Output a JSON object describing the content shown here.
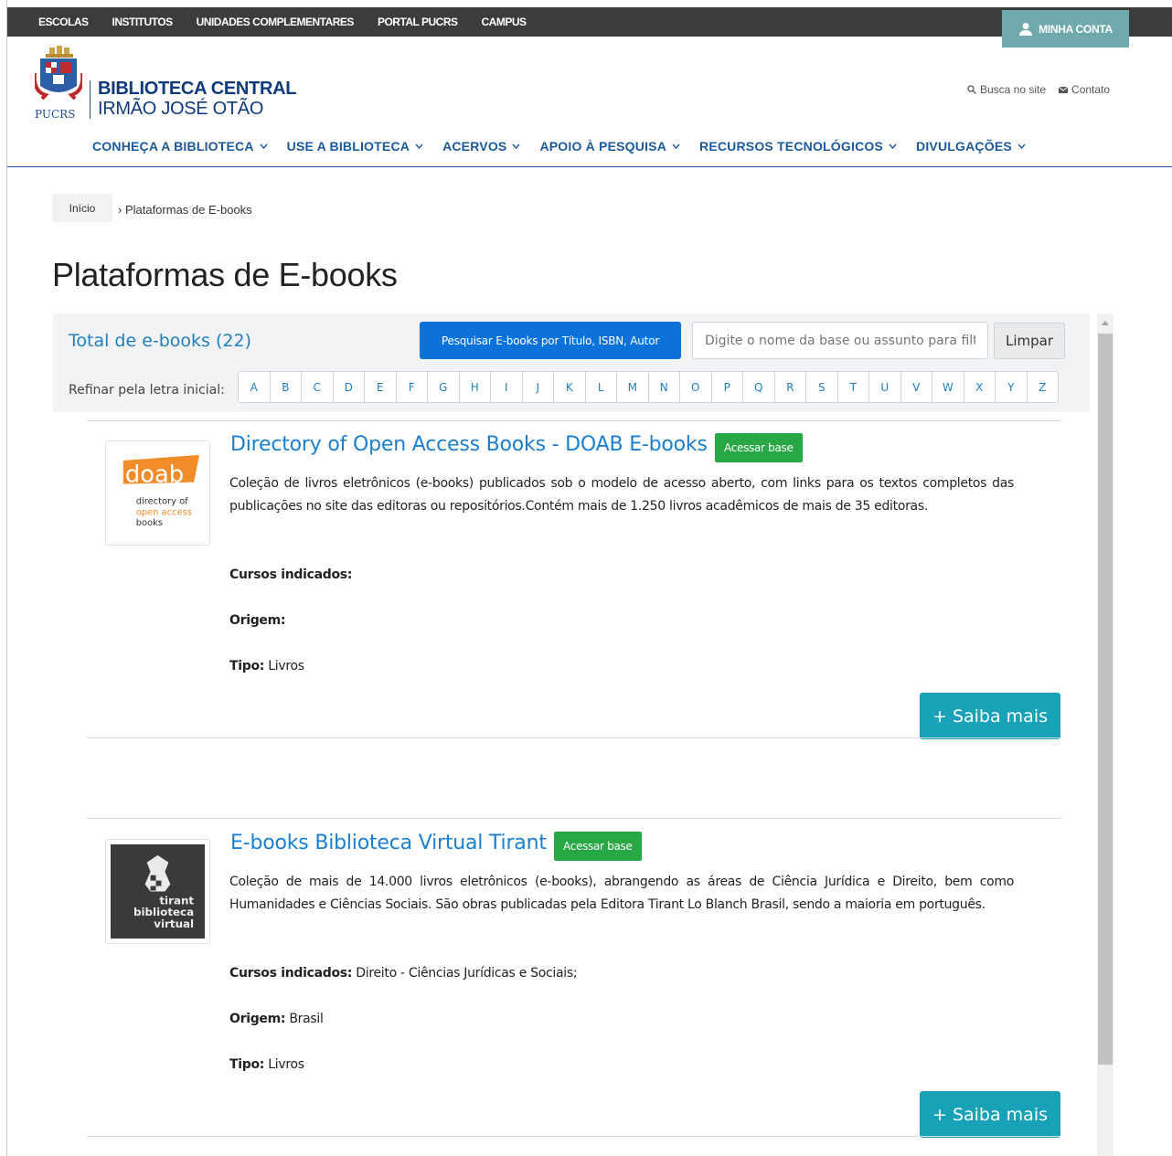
{
  "topbar": {
    "links": [
      "ESCOLAS",
      "INSTITUTOS",
      "UNIDADES COMPLEMENTARES",
      "PORTAL PUCRS",
      "CAMPUS"
    ],
    "account_label": "MINHA CONTA"
  },
  "header": {
    "logo_text": "PUCRS",
    "title_line1": "BIBLIOTECA CENTRAL",
    "title_line2": "IRMÃO JOSÉ OTÃO",
    "search_link": "Busca no site",
    "contact_link": "Contato"
  },
  "nav": {
    "items": [
      "CONHEÇA A BIBLIOTECA",
      "USE A BIBLIOTECA",
      "ACERVOS",
      "APOIO À PESQUISA",
      "RECURSOS TECNOLÓGICOS",
      "DIVULGAÇÕES"
    ]
  },
  "breadcrumb": {
    "home": "Início",
    "current": "› Plataformas de E-books"
  },
  "page": {
    "title": "Plataformas de E-books"
  },
  "filters": {
    "total_label": "Total de e-books (22)",
    "search_button": "Pesquisar E-books por Título, ISBN, Autor",
    "search_placeholder": "Digite o nome da base ou assunto para filtrar",
    "clear_button": "Limpar",
    "refine_label": "Refinar pela letra inicial:",
    "letters": [
      "A",
      "B",
      "C",
      "D",
      "E",
      "F",
      "G",
      "H",
      "I",
      "J",
      "K",
      "L",
      "M",
      "N",
      "O",
      "P",
      "Q",
      "R",
      "S",
      "T",
      "U",
      "V",
      "W",
      "X",
      "Y",
      "Z"
    ]
  },
  "entries": [
    {
      "title": "Directory of Open Access Books - DOAB E-books",
      "access_label": "Acessar base",
      "description": "Coleção de livros eletrônicos (e-books) publicados sob o modelo de acesso aberto, com links para os textos completos das publicações no site das editoras ou repositórios.Contém mais de 1.250 livros acadêmicos de mais de 35 editoras.",
      "courses_label": "Cursos indicados:",
      "courses_value": "",
      "origin_label": "Origem:",
      "origin_value": "",
      "type_label": "Tipo:",
      "type_value": " Livros",
      "more_label": "+ Saiba mais",
      "logo": {
        "word": "doab",
        "line1": "directory of",
        "line2": "open access",
        "line3": "books",
        "accent": "#f28c28"
      }
    },
    {
      "title": "E-books Biblioteca Virtual Tirant",
      "access_label": "Acessar base",
      "description": "Coleção de mais de 14.000 livros eletrônicos (e-books), abrangendo as áreas de Ciência Jurídica e Direito, bem como Humanidades e Ciências Sociais. São obras publicadas pela Editora Tirant Lo Blanch Brasil, sendo a maioria em português.",
      "courses_label": "Cursos indicados:",
      "courses_value": " Direito - Ciências Jurídicas e Sociais;",
      "origin_label": "Origem:",
      "origin_value": " Brasil",
      "type_label": "Tipo:",
      "type_value": " Livros",
      "more_label": "+ Saiba mais",
      "logo": {
        "line1": "tirant",
        "line2": "biblioteca",
        "line3": "virtual"
      }
    }
  ],
  "colors": {
    "topbar": "#3c3c3c",
    "nav_text": "#1a5a9b",
    "link_blue": "#1a7ed1",
    "success": "#28a745",
    "info": "#17a2b8",
    "primary": "#0a72d8"
  }
}
